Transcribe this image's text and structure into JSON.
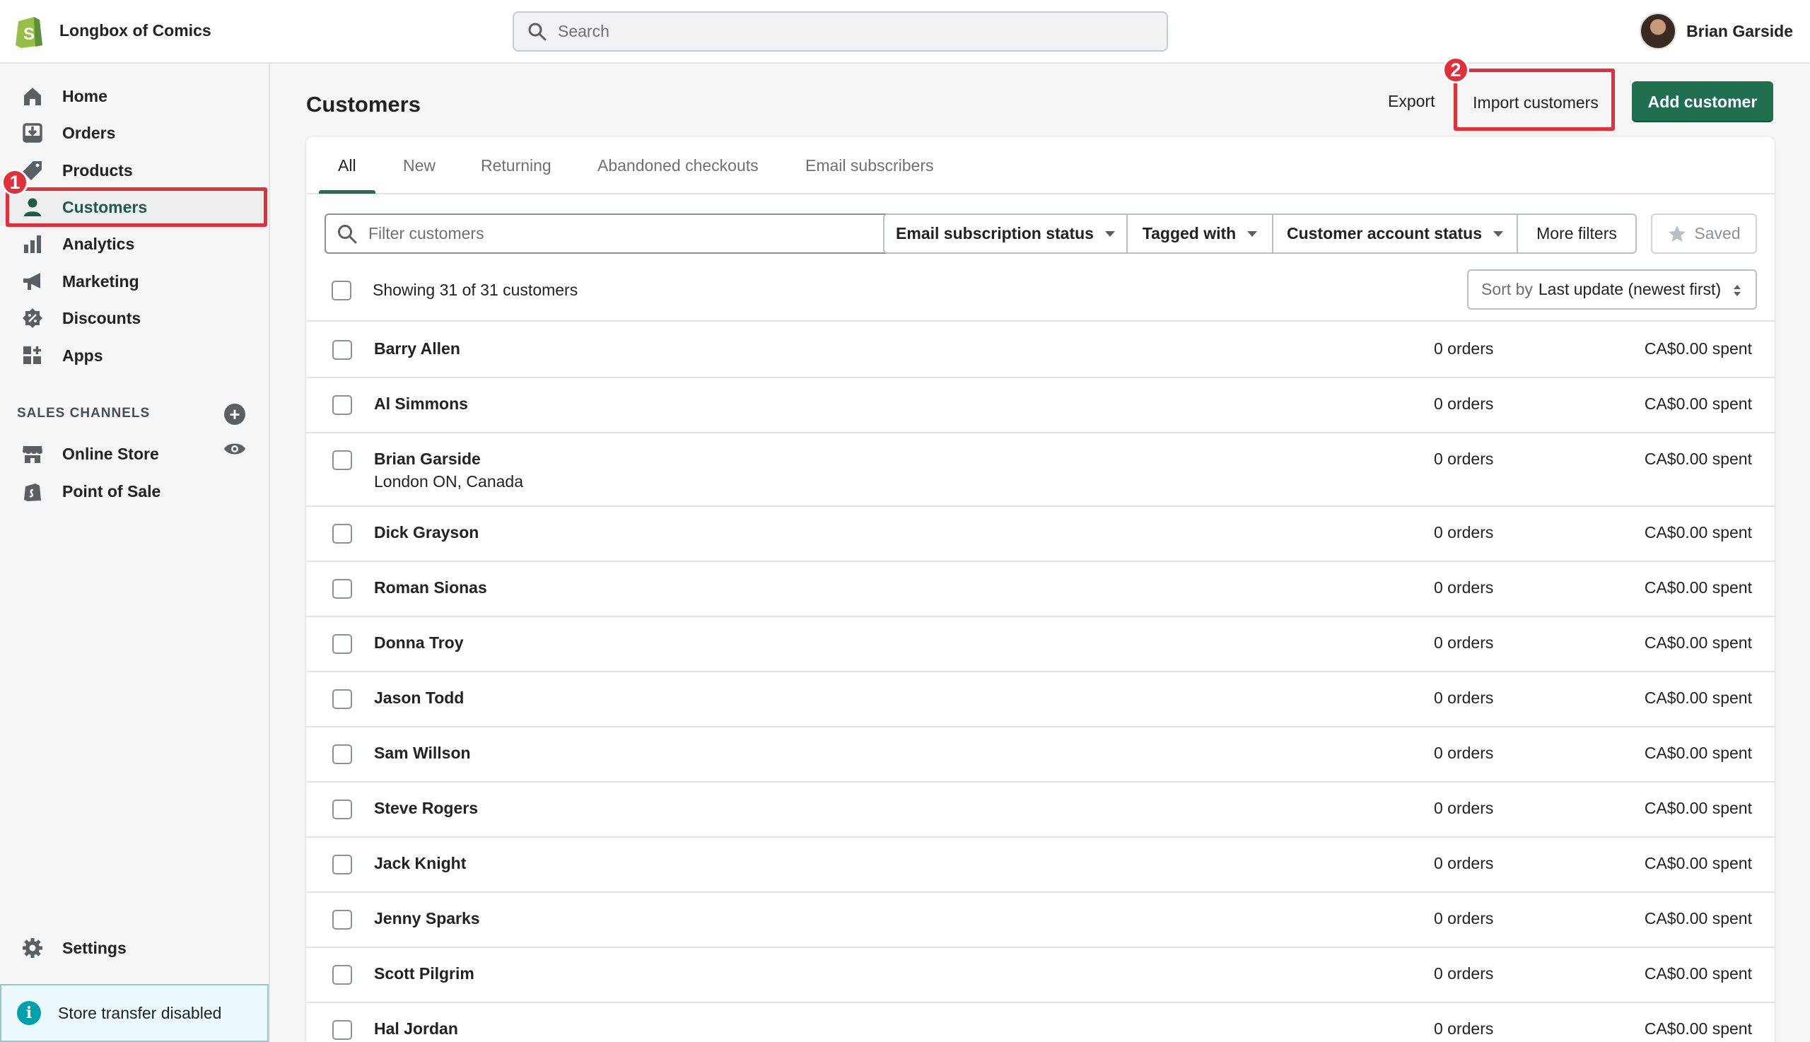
{
  "topbar": {
    "store_name": "Longbox of Comics",
    "search_placeholder": "Search",
    "user_name": "Brian Garside"
  },
  "sidebar": {
    "items": [
      {
        "label": "Home",
        "icon": "home-icon"
      },
      {
        "label": "Orders",
        "icon": "orders-icon"
      },
      {
        "label": "Products",
        "icon": "tag-icon"
      },
      {
        "label": "Customers",
        "icon": "person-icon"
      },
      {
        "label": "Analytics",
        "icon": "bar-chart-icon"
      },
      {
        "label": "Marketing",
        "icon": "megaphone-icon"
      },
      {
        "label": "Discounts",
        "icon": "discount-icon"
      },
      {
        "label": "Apps",
        "icon": "apps-icon"
      }
    ],
    "sales_channels_title": "SALES CHANNELS",
    "channels": [
      {
        "label": "Online Store",
        "icon": "store-icon"
      },
      {
        "label": "Point of Sale",
        "icon": "bag-icon"
      }
    ],
    "settings_label": "Settings",
    "transfer_notice": "Store transfer disabled"
  },
  "annotations": {
    "badge1": "1",
    "badge2": "2"
  },
  "header": {
    "title": "Customers",
    "export_label": "Export",
    "import_label": "Import customers",
    "add_label": "Add customer"
  },
  "tabs": [
    "All",
    "New",
    "Returning",
    "Abandoned checkouts",
    "Email subscribers"
  ],
  "filters": {
    "placeholder": "Filter customers",
    "email_status": "Email subscription status",
    "tagged_with": "Tagged with",
    "account_status": "Customer account status",
    "more_filters": "More filters",
    "saved": "Saved"
  },
  "list": {
    "showing": "Showing 31 of 31 customers",
    "sort_prefix": "Sort by",
    "sort_value": "Last update (newest first)",
    "customers": [
      {
        "name": "Barry Allen",
        "location": "",
        "orders": "0 orders",
        "spent": "CA$0.00 spent"
      },
      {
        "name": "Al Simmons",
        "location": "",
        "orders": "0 orders",
        "spent": "CA$0.00 spent"
      },
      {
        "name": "Brian Garside",
        "location": "London ON, Canada",
        "orders": "0 orders",
        "spent": "CA$0.00 spent"
      },
      {
        "name": "Dick Grayson",
        "location": "",
        "orders": "0 orders",
        "spent": "CA$0.00 spent"
      },
      {
        "name": "Roman Sionas",
        "location": "",
        "orders": "0 orders",
        "spent": "CA$0.00 spent"
      },
      {
        "name": "Donna Troy",
        "location": "",
        "orders": "0 orders",
        "spent": "CA$0.00 spent"
      },
      {
        "name": "Jason Todd",
        "location": "",
        "orders": "0 orders",
        "spent": "CA$0.00 spent"
      },
      {
        "name": "Sam Willson",
        "location": "",
        "orders": "0 orders",
        "spent": "CA$0.00 spent"
      },
      {
        "name": "Steve Rogers",
        "location": "",
        "orders": "0 orders",
        "spent": "CA$0.00 spent"
      },
      {
        "name": "Jack Knight",
        "location": "",
        "orders": "0 orders",
        "spent": "CA$0.00 spent"
      },
      {
        "name": "Jenny Sparks",
        "location": "",
        "orders": "0 orders",
        "spent": "CA$0.00 spent"
      },
      {
        "name": "Scott Pilgrim",
        "location": "",
        "orders": "0 orders",
        "spent": "CA$0.00 spent"
      },
      {
        "name": "Hal Jordan",
        "location": "",
        "orders": "0 orders",
        "spent": "CA$0.00 spent"
      }
    ]
  },
  "colors": {
    "accent_green": "#1f6f50",
    "annotation_red": "#e2303a"
  }
}
